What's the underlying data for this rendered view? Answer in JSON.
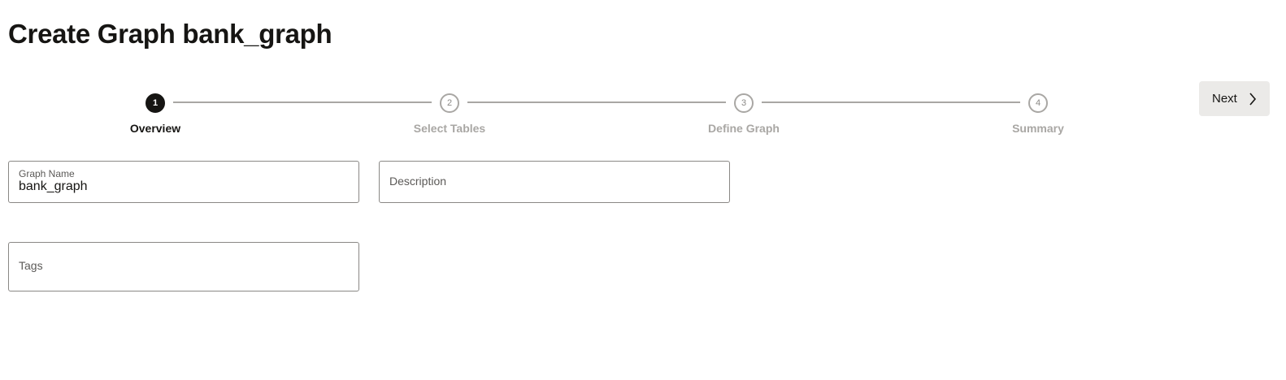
{
  "page": {
    "title": "Create Graph bank_graph"
  },
  "stepper": {
    "steps": [
      {
        "number": "1",
        "label": "Overview",
        "active": true
      },
      {
        "number": "2",
        "label": "Select Tables",
        "active": false
      },
      {
        "number": "3",
        "label": "Define Graph",
        "active": false
      },
      {
        "number": "4",
        "label": "Summary",
        "active": false
      }
    ]
  },
  "actions": {
    "next_label": "Next",
    "next_icon": "chevron-right-icon"
  },
  "form": {
    "graph_name": {
      "label": "Graph Name",
      "value": "bank_graph"
    },
    "description": {
      "placeholder": "Description",
      "value": ""
    },
    "tags": {
      "placeholder": "Tags",
      "value": ""
    }
  },
  "colors": {
    "text": "#161513",
    "muted": "#a9a7a4",
    "button_bg": "#ebeae8",
    "border": "#8a8885"
  }
}
